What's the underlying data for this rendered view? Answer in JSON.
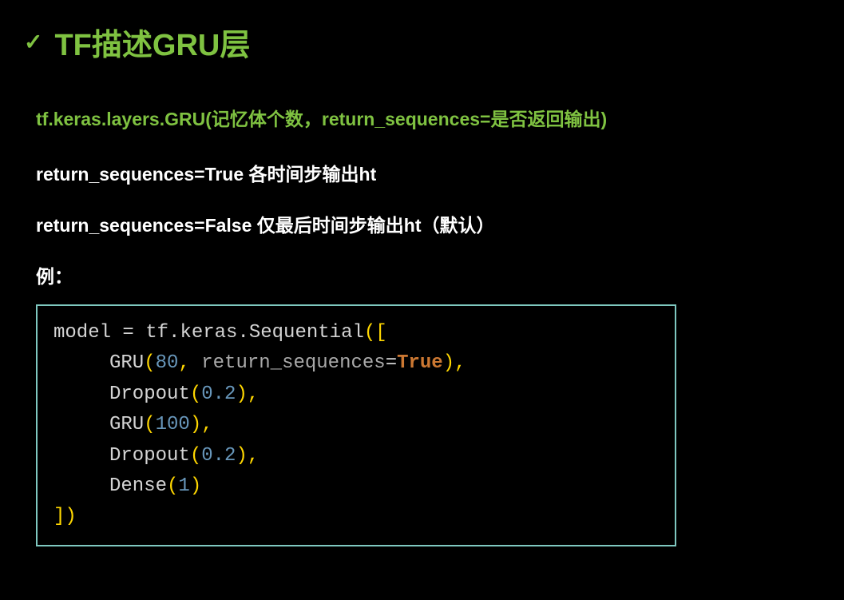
{
  "title": "TF描述GRU层",
  "api_signature": "tf.keras.layers.GRU(记忆体个数，return_sequences=是否返回输出)",
  "param_true": "return_sequences=True  各时间步输出ht",
  "param_false": "return_sequences=False 仅最后时间步输出ht（默认）",
  "example_label": "例：",
  "code": {
    "line1_a": "model ",
    "line1_b": "=",
    "line1_c": " tf.keras.Sequential",
    "line1_d": "([",
    "line2_a": "GRU",
    "line2_b": "(",
    "line2_c": "80",
    "line2_d": ", ",
    "line2_e": "return_sequences",
    "line2_f": "=",
    "line2_g": "True",
    "line2_h": "),",
    "line3_a": "Dropout",
    "line3_b": "(",
    "line3_c": "0.2",
    "line3_d": "),",
    "line4_a": "GRU",
    "line4_b": "(",
    "line4_c": "100",
    "line4_d": "),",
    "line5_a": "Dropout",
    "line5_b": "(",
    "line5_c": "0.2",
    "line5_d": "),",
    "line6_a": "Dense",
    "line6_b": "(",
    "line6_c": "1",
    "line6_d": ")",
    "line7": "])"
  }
}
